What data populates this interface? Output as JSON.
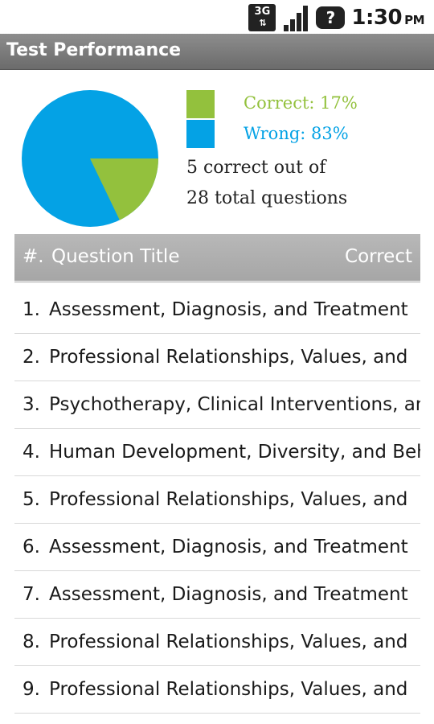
{
  "status_bar": {
    "network_badge": "3G",
    "network_arrows": "⇅",
    "help_badge": "?",
    "time": "1:30",
    "am_pm": "PM",
    "icons": [
      "3g-data-icon",
      "signal-strength-icon",
      "help-icon"
    ]
  },
  "header": {
    "title": "Test Performance"
  },
  "summary": {
    "legend": [
      {
        "label": "Correct: 17%",
        "color": "#93c13d"
      },
      {
        "label": "Wrong: 83%",
        "color": "#04a2e5"
      }
    ],
    "line1": "5 correct out of",
    "line2": "28 total questions"
  },
  "pie_data": {
    "correct_count": 5,
    "total_count": 28,
    "correct_color": "#93c13d",
    "wrong_color": "#04a2e5"
  },
  "table": {
    "columns": {
      "number": "#.",
      "title": "Question Title",
      "correct": "Correct"
    },
    "rows": [
      {
        "number": "1.",
        "title": "Assessment, Diagnosis, and Treatment"
      },
      {
        "number": "2.",
        "title": "Professional Relationships, Values, and"
      },
      {
        "number": "3.",
        "title": "Psychotherapy, Clinical Interventions, and"
      },
      {
        "number": "4.",
        "title": "Human Development, Diversity, and Behavior"
      },
      {
        "number": "5.",
        "title": "Professional Relationships, Values, and"
      },
      {
        "number": "6.",
        "title": "Assessment, Diagnosis, and Treatment"
      },
      {
        "number": "7.",
        "title": "Assessment, Diagnosis, and Treatment"
      },
      {
        "number": "8.",
        "title": "Professional Relationships, Values, and"
      },
      {
        "number": "9.",
        "title": "Professional Relationships, Values, and"
      }
    ]
  }
}
